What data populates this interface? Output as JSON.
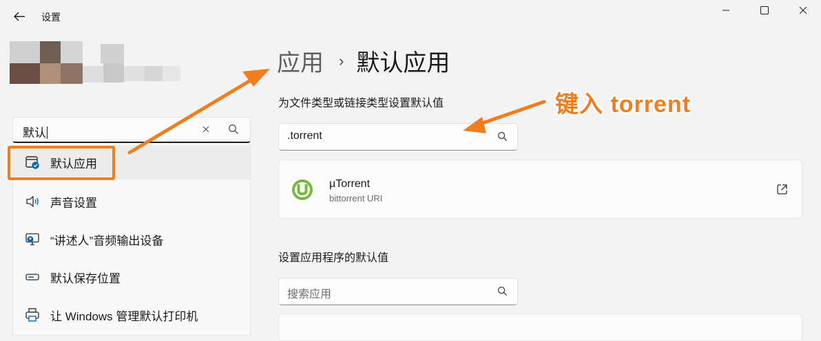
{
  "window": {
    "title": "设置"
  },
  "search": {
    "value": "默认"
  },
  "suggestions": [
    {
      "label": "默认应用",
      "icon": "default-apps-icon"
    },
    {
      "label": "声音设置",
      "icon": "speaker-icon"
    },
    {
      "label": "“讲述人”音频输出设备",
      "icon": "narrator-display-icon"
    },
    {
      "label": "默认保存位置",
      "icon": "storage-drive-icon"
    },
    {
      "label": "让 Windows 管理默认打印机",
      "icon": "printer-icon"
    }
  ],
  "breadcrumb": {
    "parent": "应用",
    "separator": "›",
    "current": "默认应用"
  },
  "filetype_section": {
    "title": "为文件类型或链接类型设置默认值",
    "input_value": ".torrent"
  },
  "result_app": {
    "name": "µTorrent",
    "subtitle": "bittorrent URI"
  },
  "apps_section": {
    "title": "设置应用程序的默认值",
    "search_placeholder": "搜索应用"
  },
  "annotation": {
    "text": "键入 torrent"
  },
  "colors": {
    "annotation_orange": "#f07d1e",
    "accent_blue": "#0067c0",
    "utorrent_green": "#76b83f"
  }
}
